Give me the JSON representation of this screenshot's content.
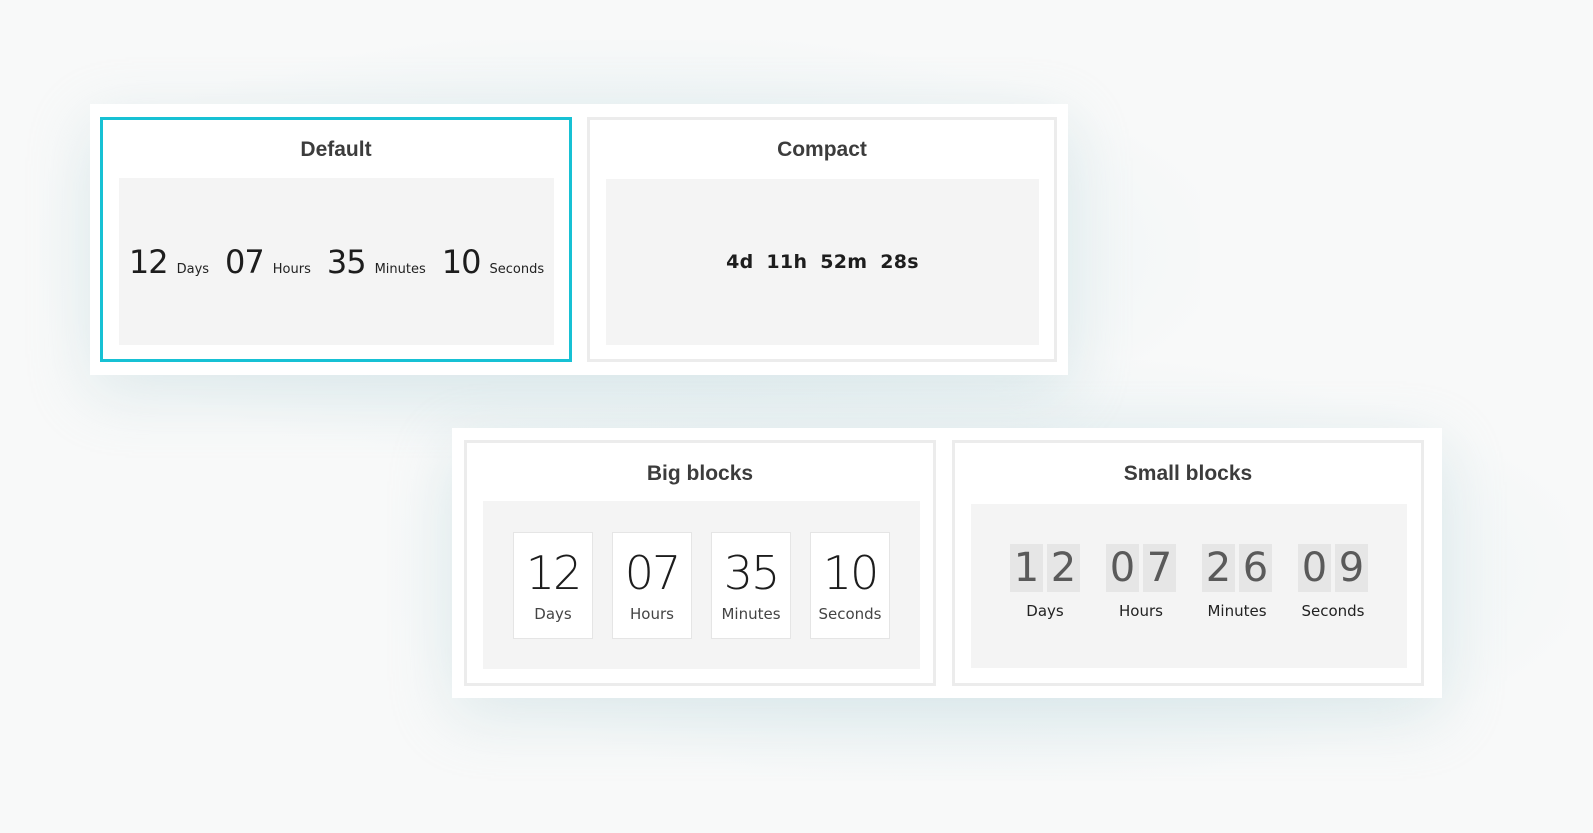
{
  "variants": {
    "default": {
      "title": "Default",
      "selected": true,
      "units": [
        {
          "value": "12",
          "label": "Days"
        },
        {
          "value": "07",
          "label": "Hours"
        },
        {
          "value": "35",
          "label": "Minutes"
        },
        {
          "value": "10",
          "label": "Seconds"
        }
      ]
    },
    "compact": {
      "title": "Compact",
      "text": "4d 11h 52m 28s"
    },
    "big_blocks": {
      "title": "Big blocks",
      "units": [
        {
          "value": "12",
          "label": "Days"
        },
        {
          "value": "07",
          "label": "Hours"
        },
        {
          "value": "35",
          "label": "Minutes"
        },
        {
          "value": "10",
          "label": "Seconds"
        }
      ]
    },
    "small_blocks": {
      "title": "Small blocks",
      "units": [
        {
          "digits": [
            "1",
            "2"
          ],
          "label": "Days"
        },
        {
          "digits": [
            "0",
            "7"
          ],
          "label": "Hours"
        },
        {
          "digits": [
            "2",
            "6"
          ],
          "label": "Minutes"
        },
        {
          "digits": [
            "0",
            "9"
          ],
          "label": "Seconds"
        }
      ]
    }
  },
  "colors": {
    "selected_border": "#17c1d4",
    "card_border": "#ececec",
    "inner_background": "#f4f4f4",
    "digit_tile": "#e6e6e6"
  }
}
